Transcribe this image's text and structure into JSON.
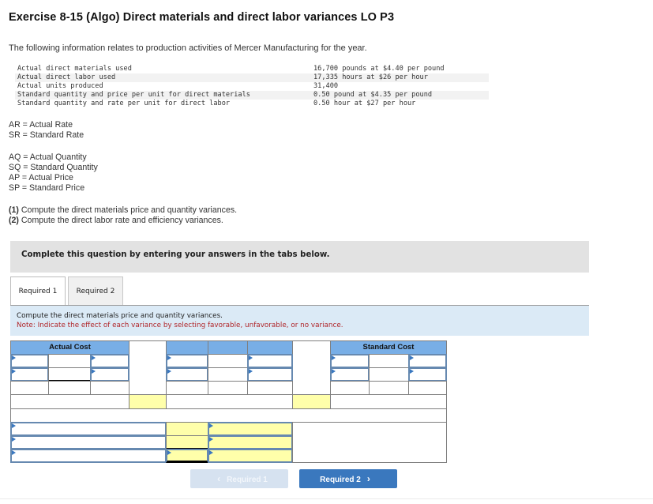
{
  "title": "Exercise 8-15 (Algo) Direct materials and direct labor variances LO P3",
  "intro": "The following information relates to production activities of Mercer Manufacturing for the year.",
  "given": [
    {
      "label": "Actual direct materials used",
      "value": "16,700 pounds at $4.40 per pound"
    },
    {
      "label": "Actual direct labor used",
      "value": "17,335 hours at $26 per hour"
    },
    {
      "label": "Actual units produced",
      "value": "31,400"
    },
    {
      "label": "Standard quantity and price per unit for direct materials",
      "value": "0.50 pound at $4.35 per pound"
    },
    {
      "label": "Standard quantity and rate per unit for direct labor",
      "value": "0.50 hour at $27 per hour"
    }
  ],
  "abbreviations_rate": [
    "AR = Actual Rate",
    "SR = Standard Rate"
  ],
  "abbreviations_qty": [
    "AQ = Actual Quantity",
    "SQ = Standard Quantity",
    "AP = Actual Price",
    "SP = Standard Price"
  ],
  "requirements": [
    {
      "num": "(1)",
      "text": " Compute the direct materials price and quantity variances."
    },
    {
      "num": "(2)",
      "text": " Compute the direct labor rate and efficiency variances."
    }
  ],
  "banner": "Complete this question by entering your answers in the tabs below.",
  "tabs": [
    {
      "label": "Required 1",
      "active": true
    },
    {
      "label": "Required 2",
      "active": false
    }
  ],
  "instructions": {
    "line1": "Compute the direct materials price and quantity variances.",
    "note": "Note: Indicate the effect of each variance by selecting favorable, unfavorable, or no variance."
  },
  "table": {
    "actual_cost_header": "Actual Cost",
    "standard_cost_header": "Standard Cost",
    "inputs": {}
  },
  "nav": {
    "prev_label": "Required 1",
    "next_label": "Required 2"
  }
}
